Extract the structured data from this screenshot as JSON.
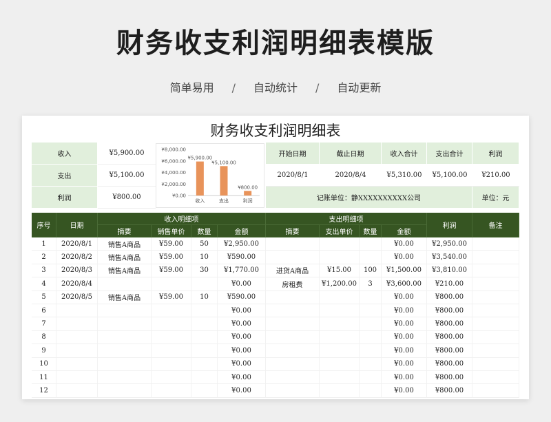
{
  "header": {
    "title": "财务收支利润明细表模版",
    "tags": [
      "简单易用",
      "自动统计",
      "自动更新"
    ],
    "sep": "/"
  },
  "sheet": {
    "title": "财务收支利润明细表",
    "summary": [
      {
        "label": "收入",
        "value": "¥5,900.00"
      },
      {
        "label": "支出",
        "value": "¥5,100.00"
      },
      {
        "label": "利润",
        "value": "¥800.00"
      }
    ],
    "info_headers": [
      "开始日期",
      "截止日期",
      "收入合计",
      "支出合计",
      "利润"
    ],
    "info_values": [
      "2020/8/1",
      "2020/8/4",
      "¥5,310.00",
      "¥5,100.00",
      "¥210.00"
    ],
    "company": "记账单位：静XXXXXXXXXX公司",
    "unit": "单位：元",
    "table_head": {
      "seq": "序号",
      "date": "日期",
      "income_group": "收入明细项",
      "expense_group": "支出明细项",
      "profit": "利润",
      "remark": "备注",
      "income_cols": [
        "摘要",
        "销售单价",
        "数量",
        "金额"
      ],
      "expense_cols": [
        "摘要",
        "支出单价",
        "数量",
        "金额"
      ]
    },
    "rows": [
      [
        "1",
        "2020/8/1",
        "销售A商品",
        "¥59.00",
        "50",
        "¥2,950.00",
        "",
        "",
        "",
        "¥0.00",
        "¥2,950.00",
        ""
      ],
      [
        "2",
        "2020/8/2",
        "销售A商品",
        "¥59.00",
        "10",
        "¥590.00",
        "",
        "",
        "",
        "¥0.00",
        "¥3,540.00",
        ""
      ],
      [
        "3",
        "2020/8/3",
        "销售A商品",
        "¥59.00",
        "30",
        "¥1,770.00",
        "进货A商品",
        "¥15.00",
        "100",
        "¥1,500.00",
        "¥3,810.00",
        ""
      ],
      [
        "4",
        "2020/8/4",
        "",
        "",
        "",
        "¥0.00",
        "房租费",
        "¥1,200.00",
        "3",
        "¥3,600.00",
        "¥210.00",
        ""
      ],
      [
        "5",
        "2020/8/5",
        "销售A商品",
        "¥59.00",
        "10",
        "¥590.00",
        "",
        "",
        "",
        "¥0.00",
        "¥800.00",
        ""
      ],
      [
        "6",
        "",
        "",
        "",
        "",
        "¥0.00",
        "",
        "",
        "",
        "¥0.00",
        "¥800.00",
        ""
      ],
      [
        "7",
        "",
        "",
        "",
        "",
        "¥0.00",
        "",
        "",
        "",
        "¥0.00",
        "¥800.00",
        ""
      ],
      [
        "8",
        "",
        "",
        "",
        "",
        "¥0.00",
        "",
        "",
        "",
        "¥0.00",
        "¥800.00",
        ""
      ],
      [
        "9",
        "",
        "",
        "",
        "",
        "¥0.00",
        "",
        "",
        "",
        "¥0.00",
        "¥800.00",
        ""
      ],
      [
        "10",
        "",
        "",
        "",
        "",
        "¥0.00",
        "",
        "",
        "",
        "¥0.00",
        "¥800.00",
        ""
      ],
      [
        "11",
        "",
        "",
        "",
        "",
        "¥0.00",
        "",
        "",
        "",
        "¥0.00",
        "¥800.00",
        ""
      ],
      [
        "12",
        "",
        "",
        "",
        "",
        "¥0.00",
        "",
        "",
        "",
        "¥0.00",
        "¥800.00",
        ""
      ]
    ]
  },
  "chart_data": {
    "type": "bar",
    "categories": [
      "收入",
      "支出",
      "利润"
    ],
    "values": [
      5900,
      5100,
      800
    ],
    "data_labels": [
      "¥5,900.00",
      "¥5,100.00",
      "¥800.00"
    ],
    "y_ticks": [
      "¥0.00",
      "¥2,000.00",
      "¥4,000.00",
      "¥6,000.00",
      "¥8,000.00"
    ],
    "ylim": [
      0,
      8000
    ],
    "bar_color": "#e8935a",
    "grid": false,
    "legend": "none"
  },
  "colors": {
    "header_green": "#365522",
    "light_green": "#e1efdc"
  }
}
